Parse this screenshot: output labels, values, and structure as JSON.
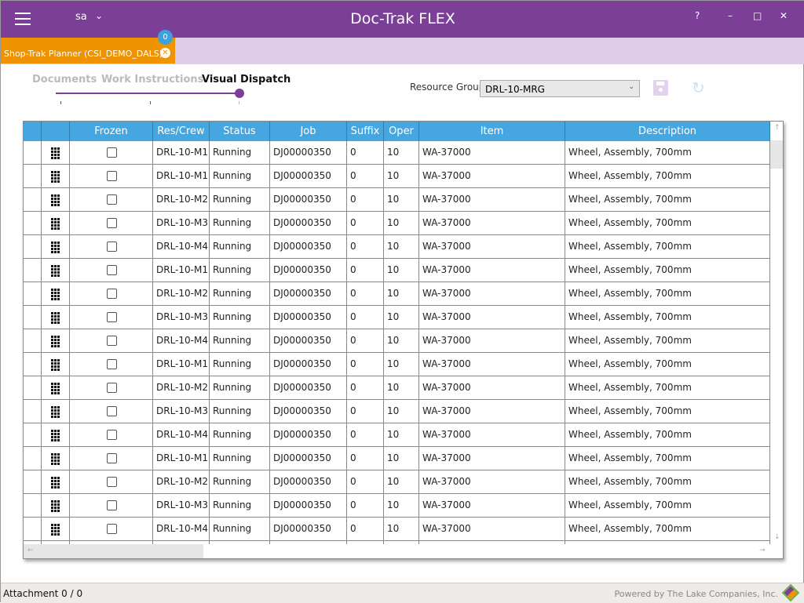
{
  "titlebar": {
    "user": "sa",
    "title": "Doc-Trak FLEX",
    "help": "?",
    "minimize": "–",
    "maximize": "□",
    "close": "✕"
  },
  "tab": {
    "label": "Shop-Trak Planner (CSI_DEMO_DALS)",
    "badge": "0",
    "close": "✕"
  },
  "steps": [
    "Documents",
    "Work Instructions",
    "Visual Dispatch"
  ],
  "active_step": 2,
  "resource_group": {
    "label": "Resource Group",
    "value": "DRL-10-MRG"
  },
  "grid": {
    "columns": [
      "",
      "",
      "Frozen",
      "Res/Crew",
      "Status",
      "Job",
      "Suffix",
      "Oper",
      "Item",
      "Description"
    ],
    "rows": [
      [
        "DRL-10-M1",
        "Running",
        "DJ00000350",
        "0",
        "10",
        "WA-37000",
        "Wheel, Assembly, 700mm"
      ],
      [
        "DRL-10-M1",
        "Running",
        "DJ00000350",
        "0",
        "10",
        "WA-37000",
        "Wheel, Assembly, 700mm"
      ],
      [
        "DRL-10-M2",
        "Running",
        "DJ00000350",
        "0",
        "10",
        "WA-37000",
        "Wheel, Assembly, 700mm"
      ],
      [
        "DRL-10-M3",
        "Running",
        "DJ00000350",
        "0",
        "10",
        "WA-37000",
        "Wheel, Assembly, 700mm"
      ],
      [
        "DRL-10-M4",
        "Running",
        "DJ00000350",
        "0",
        "10",
        "WA-37000",
        "Wheel, Assembly, 700mm"
      ],
      [
        "DRL-10-M1",
        "Running",
        "DJ00000350",
        "0",
        "10",
        "WA-37000",
        "Wheel, Assembly, 700mm"
      ],
      [
        "DRL-10-M2",
        "Running",
        "DJ00000350",
        "0",
        "10",
        "WA-37000",
        "Wheel, Assembly, 700mm"
      ],
      [
        "DRL-10-M3",
        "Running",
        "DJ00000350",
        "0",
        "10",
        "WA-37000",
        "Wheel, Assembly, 700mm"
      ],
      [
        "DRL-10-M4",
        "Running",
        "DJ00000350",
        "0",
        "10",
        "WA-37000",
        "Wheel, Assembly, 700mm"
      ],
      [
        "DRL-10-M1",
        "Running",
        "DJ00000350",
        "0",
        "10",
        "WA-37000",
        "Wheel, Assembly, 700mm"
      ],
      [
        "DRL-10-M2",
        "Running",
        "DJ00000350",
        "0",
        "10",
        "WA-37000",
        "Wheel, Assembly, 700mm"
      ],
      [
        "DRL-10-M3",
        "Running",
        "DJ00000350",
        "0",
        "10",
        "WA-37000",
        "Wheel, Assembly, 700mm"
      ],
      [
        "DRL-10-M4",
        "Running",
        "DJ00000350",
        "0",
        "10",
        "WA-37000",
        "Wheel, Assembly, 700mm"
      ],
      [
        "DRL-10-M1",
        "Running",
        "DJ00000350",
        "0",
        "10",
        "WA-37000",
        "Wheel, Assembly, 700mm"
      ],
      [
        "DRL-10-M2",
        "Running",
        "DJ00000350",
        "0",
        "10",
        "WA-37000",
        "Wheel, Assembly, 700mm"
      ],
      [
        "DRL-10-M3",
        "Running",
        "DJ00000350",
        "0",
        "10",
        "WA-37000",
        "Wheel, Assembly, 700mm"
      ],
      [
        "DRL-10-M4",
        "Running",
        "DJ00000350",
        "0",
        "10",
        "WA-37000",
        "Wheel, Assembly, 700mm"
      ],
      [
        "",
        "",
        "",
        "",
        "",
        "",
        ""
      ]
    ]
  },
  "statusbar": {
    "attachment": "Attachment 0 / 0",
    "powered": "Powered by The Lake Companies, Inc."
  },
  "colors": {
    "brand": "#7b3f98",
    "tab": "#f09300",
    "header": "#45a6e0"
  }
}
